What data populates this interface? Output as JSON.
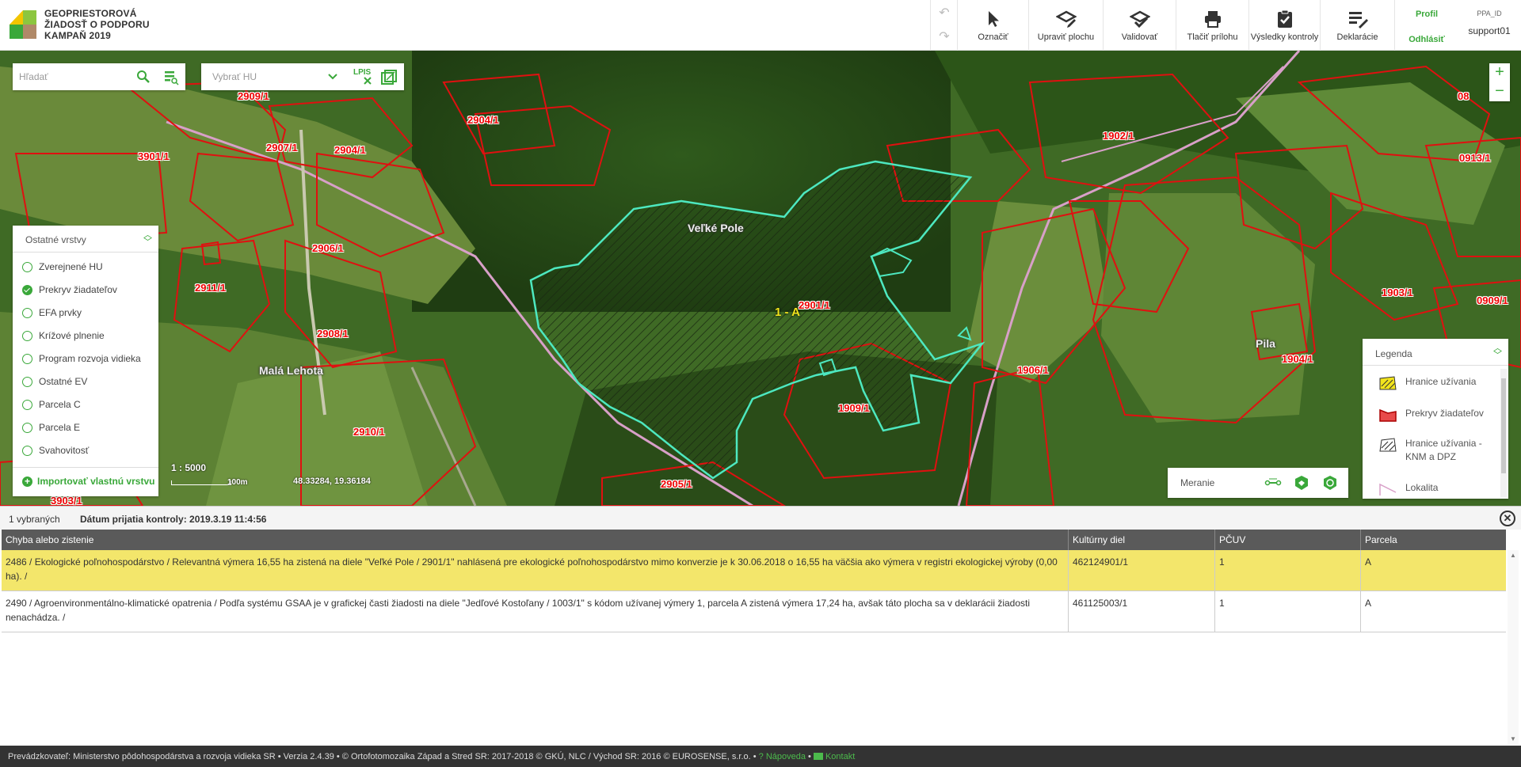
{
  "brand": {
    "line1": "GEOPRIESTOROVÁ",
    "line2": "ŽIADOSŤ O PODPORU",
    "line3": "KAMPAŇ 2019"
  },
  "toolbar": {
    "tools": [
      {
        "label": "Označiť",
        "icon": "pointer-icon"
      },
      {
        "label": "Upraviť plochu",
        "icon": "edit-area-icon"
      },
      {
        "label": "Validovať",
        "icon": "validate-icon"
      },
      {
        "label": "Tlačiť prílohu",
        "icon": "print-icon"
      },
      {
        "label": "Výsledky kontroly",
        "icon": "clipboard-check-icon"
      },
      {
        "label": "Deklarácie",
        "icon": "list-edit-icon"
      }
    ],
    "profile": "Profil",
    "logout": "Odhlásiť",
    "user_id_label": "PPA_ID",
    "username": "support01"
  },
  "search": {
    "placeholder": "Hľadať"
  },
  "hu_select": {
    "placeholder": "Vybrať HU",
    "lpis_label": "LPIS"
  },
  "layers": {
    "title": "Ostatné vrstvy",
    "items": [
      {
        "label": "Zverejnené HU",
        "checked": false
      },
      {
        "label": "Prekryv žiadateľov",
        "checked": true
      },
      {
        "label": "EFA prvky",
        "checked": false
      },
      {
        "label": "Krížové plnenie",
        "checked": false
      },
      {
        "label": "Program rozvoja vidieka",
        "checked": false
      },
      {
        "label": "Ostatné EV",
        "checked": false
      },
      {
        "label": "Parcela C",
        "checked": false
      },
      {
        "label": "Parcela E",
        "checked": false
      },
      {
        "label": "Svahovitosť",
        "checked": false
      }
    ],
    "import_label": "Importovať vlastnú vrstvu"
  },
  "map": {
    "scale": "1 : 5000",
    "scalebar_label": "100m",
    "coordinates": "48.33284, 19.36184",
    "places": [
      {
        "label": "Veľké Pole"
      },
      {
        "label": "Malá Lehota"
      },
      {
        "label": "Pila"
      }
    ],
    "parcel_selected": "1 - A",
    "parcels": [
      "2909/1",
      "2904/1",
      "2907/1",
      "2904/1",
      "3901/1",
      "2906/1",
      "2911/1",
      "2908/1",
      "2910/1",
      "2905/1",
      "3903/1",
      "2901/1",
      "1909/1",
      "1906/1",
      "1902/1",
      "1903/1",
      "1904/1",
      "0913/1",
      "0909/1",
      "08"
    ]
  },
  "measure": {
    "label": "Meranie"
  },
  "legend": {
    "title": "Legenda",
    "items": [
      {
        "label": "Hranice užívania",
        "icon": "usage-boundary-icon"
      },
      {
        "label": "Prekryv žiadateľov",
        "icon": "applicant-overlap-icon"
      },
      {
        "label": "Hranice užívania - KNM a DPZ",
        "icon": "usage-boundary-knm-icon"
      },
      {
        "label": "Lokalita",
        "icon": "locality-icon"
      }
    ]
  },
  "panel": {
    "selected_count": "1 vybraných",
    "date_label": "Dátum prijatia kontroly: 2019.3.19 11:4:56"
  },
  "table": {
    "columns": [
      "Chyba alebo zistenie",
      "Kultúrny diel",
      "PČUV",
      "Parcela"
    ],
    "rows": [
      {
        "finding": "2486 / Ekologické poľnohospodárstvo / Relevantná výmera 16,55 ha zistená na diele \"Veľké Pole / 2901/1\" nahlásená pre ekologické poľnohospodárstvo mimo konverzie je k 30.06.2018 o 16,55 ha väčšia ako výmera v registri ekologickej výroby (0,00 ha). /",
        "block": "462124901/1",
        "pcuv": "1",
        "parcel": "A",
        "selected": true
      },
      {
        "finding": "2490 / Agroenvironmentálno-klimatické opatrenia / Podľa systému GSAA je v grafickej časti žiadosti na diele \"Jedľové Kostoľany / 1003/1\" s kódom užívanej výmery 1, parcela A zistená výmera 17,24 ha, avšak táto plocha sa v deklarácii žiadosti nenachádza. /",
        "block": "461125003/1",
        "pcuv": "1",
        "parcel": "A",
        "selected": false
      }
    ]
  },
  "footer": {
    "text": "Prevádzkovateľ: Ministerstvo pôdohospodárstva a rozvoja vidieka SR • Verzia 2.4.39 • © Ortofotomozaika Západ a Stred SR: 2017-2018 © GKÚ, NLC / Východ SR: 2016 © EUROSENSE, s.r.o. •",
    "help": "Nápoveda",
    "contact": "Kontakt"
  },
  "colors": {
    "accent": "#3aa83a",
    "parcel_border": "#e01010",
    "selected_parcel": "#4de8c0",
    "row_highlight": "#f3e66b"
  }
}
